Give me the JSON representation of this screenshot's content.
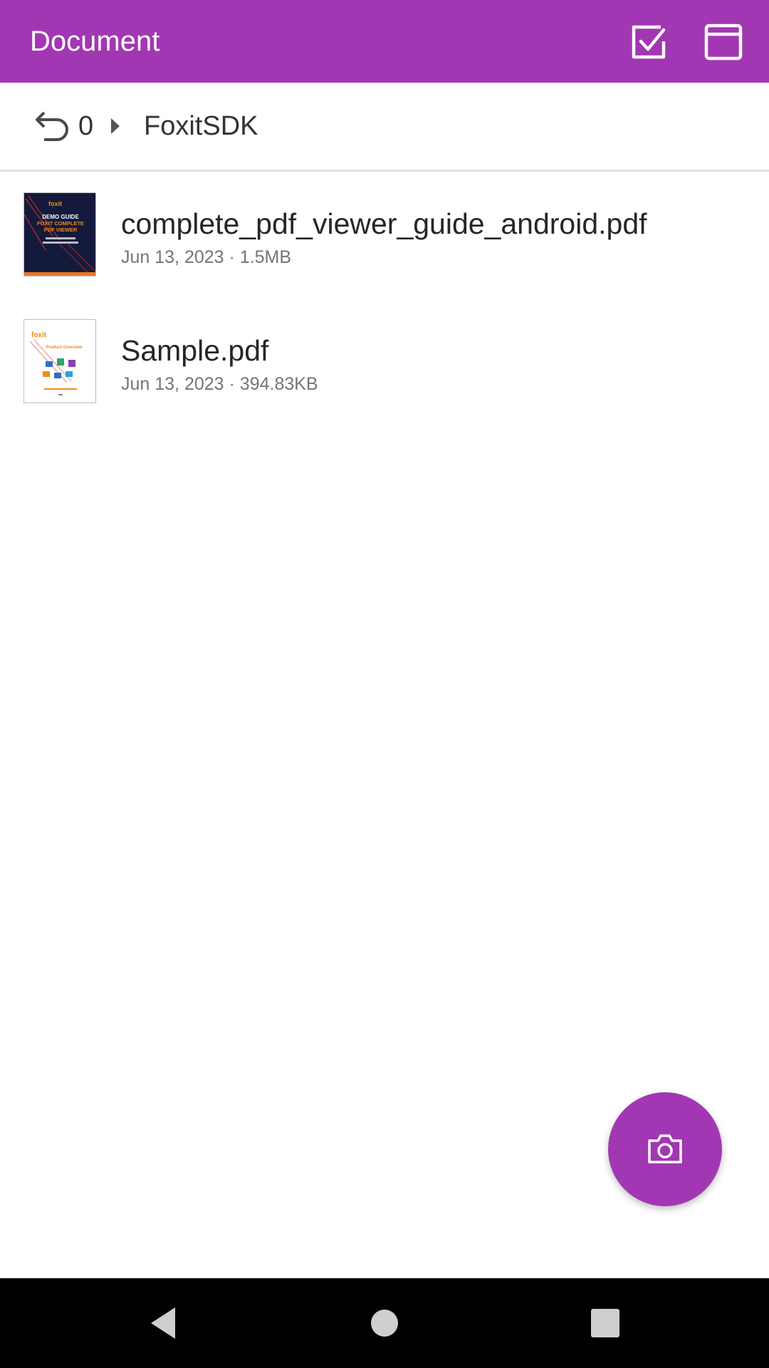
{
  "app_bar": {
    "title": "Document",
    "background_color": "#a237b3",
    "actions": [
      {
        "icon": "checkbox-select-icon"
      },
      {
        "icon": "window-icon"
      }
    ]
  },
  "breadcrumb": {
    "back_icon": "undo-arrow-icon",
    "back_count": "0",
    "separator_icon": "chevron-right-icon",
    "items": [
      "FoxitSDK"
    ]
  },
  "files": [
    {
      "name": "complete_pdf_viewer_guide_android.pdf",
      "meta": "Jun 13, 2023 · 1.5MB",
      "thumbnail": {
        "brand": "foxit",
        "lines": [
          "DEMO GUIDE",
          "FOXIT COMPLETE",
          "PDF VIEWER"
        ]
      }
    },
    {
      "name": "Sample.pdf",
      "meta": "Jun 13, 2023 · 394.83KB",
      "thumbnail": {
        "brand": "foxit",
        "lines": [
          "Product Overview"
        ]
      }
    }
  ],
  "fab": {
    "icon": "camera-icon",
    "color": "#a237b3"
  },
  "nav_bar": {
    "buttons": [
      {
        "icon": "back-triangle-icon"
      },
      {
        "icon": "home-circle-icon"
      },
      {
        "icon": "recents-square-icon"
      }
    ]
  }
}
